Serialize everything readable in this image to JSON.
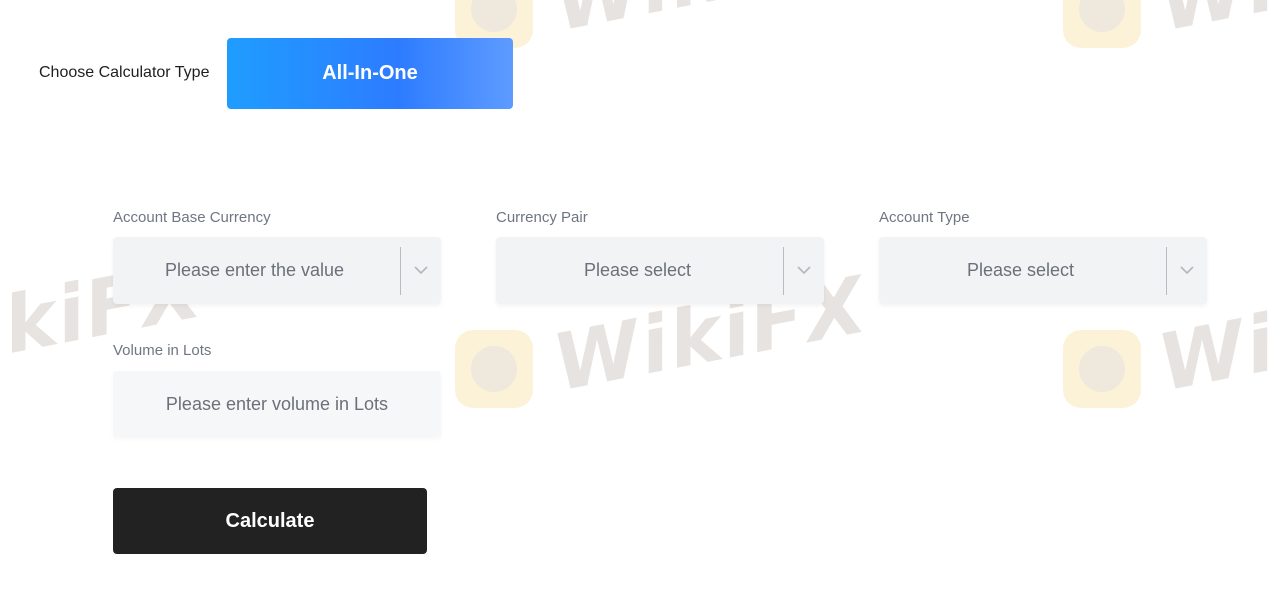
{
  "watermark": {
    "text": "WikiFX"
  },
  "calculator_type": {
    "label": "Choose Calculator Type",
    "selected": "All-In-One",
    "icon": "chevron-down-icon"
  },
  "fields": {
    "account_base_currency": {
      "label": "Account Base Currency",
      "placeholder": "Please enter the value"
    },
    "currency_pair": {
      "label": "Currency Pair",
      "placeholder": "Please select"
    },
    "account_type": {
      "label": "Account Type",
      "placeholder": "Please select"
    },
    "volume": {
      "label": "Volume in Lots",
      "placeholder": "Please enter volume in Lots"
    }
  },
  "actions": {
    "calculate_label": "Calculate"
  },
  "colors": {
    "type_select_gradient_start": "#1f9dff",
    "type_select_gradient_end": "#5e9bff",
    "input_background": "#f2f3f5",
    "button_background": "#222222"
  }
}
